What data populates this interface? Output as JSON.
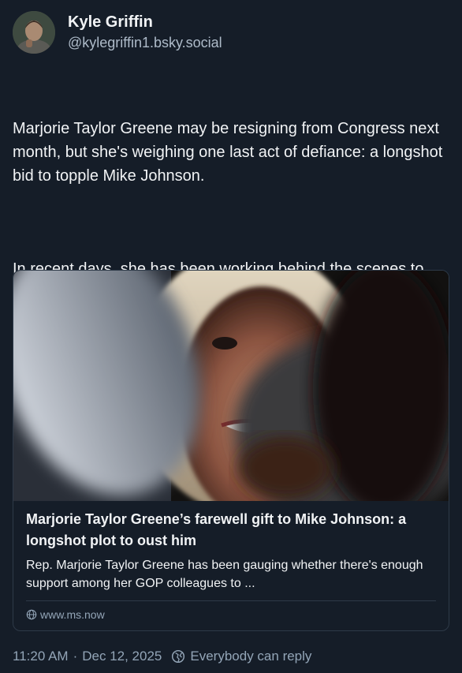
{
  "author": {
    "display_name": "Kyle Griffin",
    "handle": "@kylegriffin1.bsky.social",
    "avatar_icon": "avatar-photo"
  },
  "post": {
    "paragraphs": [
      "Marjorie Taylor Greene may be resigning from Congress next month, but she's weighing one last act of defiance: a longshot bid to topple Mike Johnson.",
      "In recent days, she has been working behind the scenes to gauge whether there's support for a motion to vacate the chair."
    ]
  },
  "link_card": {
    "title": "Marjorie Taylor Greene’s farewell gift to Mike Johnson: a longshot plot to oust him",
    "description": "Rep. Marjorie Taylor Greene has been gauging whether there's enough support among her GOP colleagues to ...",
    "domain": "www.ms.now",
    "domain_icon": "globe-icon"
  },
  "meta": {
    "time": "11:20 AM",
    "separator": "·",
    "date": "Dec 12, 2025",
    "reply_setting": "Everybody can reply",
    "reply_icon": "globe-icon"
  },
  "colors": {
    "background": "#151d28",
    "text": "#f1f3f5",
    "muted": "#93a5b7",
    "border": "#2e3a48"
  }
}
